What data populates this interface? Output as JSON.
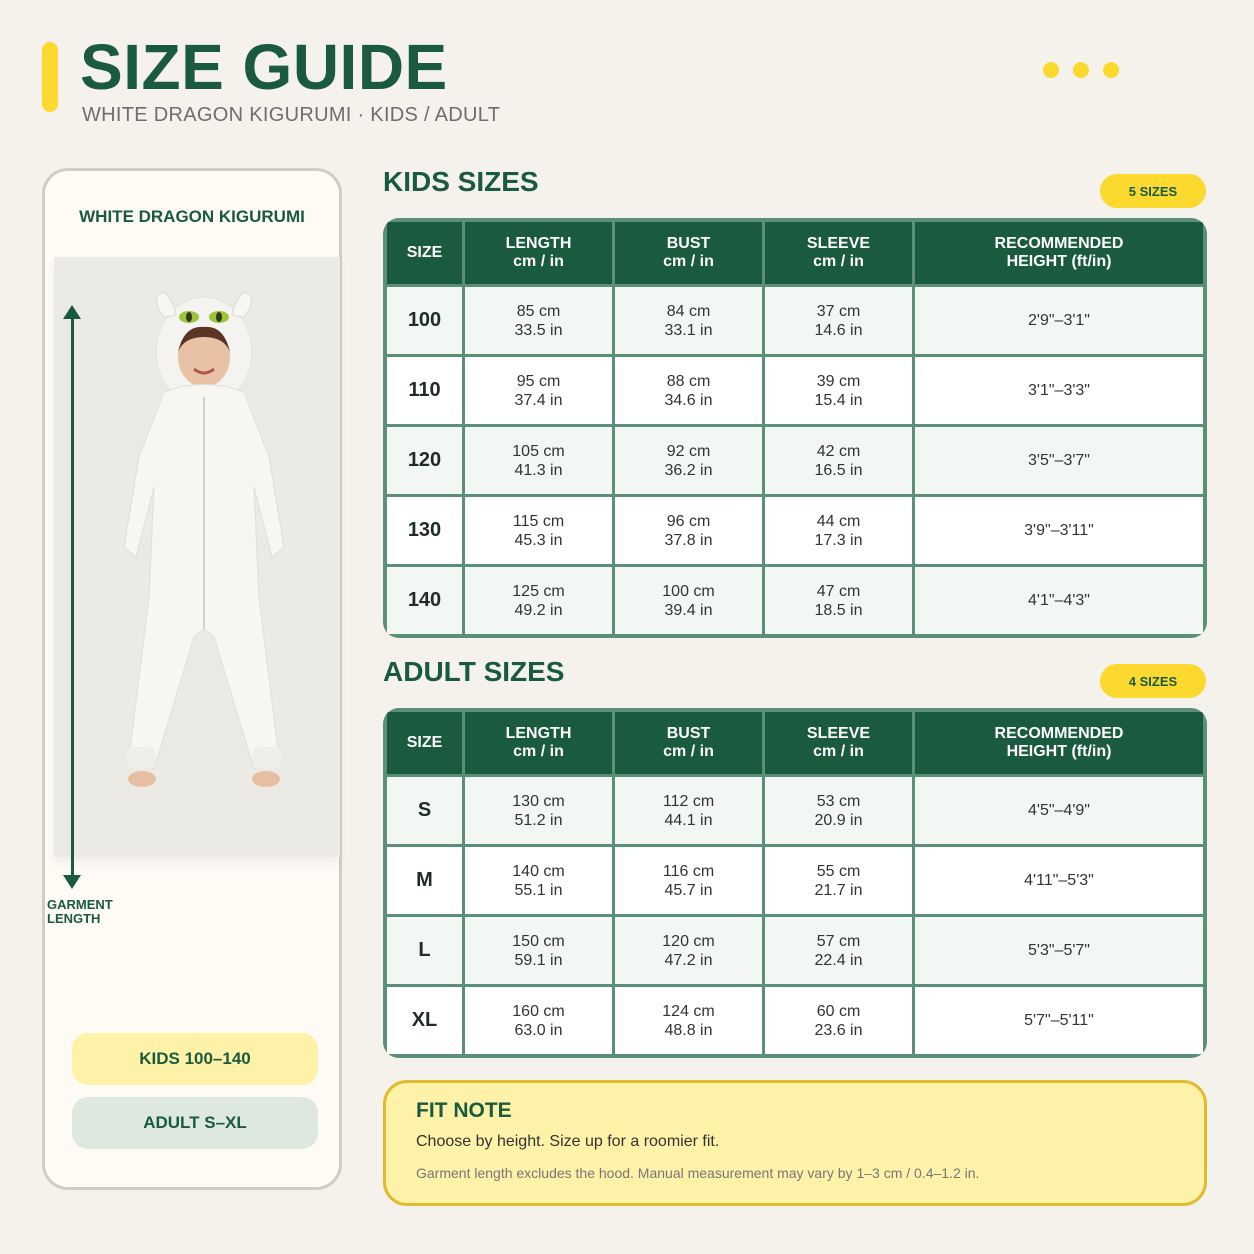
{
  "header": {
    "title": "SIZE GUIDE",
    "subtitle": "WHITE DRAGON KIGURUMI · KIDS / ADULT",
    "accent_color": "#fcd92e",
    "brand_color": "#1a5a3e"
  },
  "left_panel": {
    "title": "WHITE DRAGON KIGURUMI",
    "garment_label": "GARMENT LENGTH",
    "pill_kids": "KIDS 100–140",
    "pill_adult": "ADULT S–XL"
  },
  "kids": {
    "title": "KIDS SIZES",
    "badge": "5 SIZES",
    "headers": [
      {
        "main": "SIZE",
        "sub": ""
      },
      {
        "main": "LENGTH",
        "sub": "cm / in"
      },
      {
        "main": "BUST",
        "sub": "cm / in"
      },
      {
        "main": "SLEEVE",
        "sub": "cm / in"
      },
      {
        "main": "RECOMMENDED",
        "sub": "HEIGHT (ft/in)"
      }
    ],
    "rows": [
      {
        "size": "100",
        "length": [
          "85 cm",
          "33.5 in"
        ],
        "bust": [
          "84 cm",
          "33.1 in"
        ],
        "sleeve": [
          "37 cm",
          "14.6 in"
        ],
        "height": "2'9\"–3'1\""
      },
      {
        "size": "110",
        "length": [
          "95 cm",
          "37.4 in"
        ],
        "bust": [
          "88 cm",
          "34.6 in"
        ],
        "sleeve": [
          "39 cm",
          "15.4 in"
        ],
        "height": "3'1\"–3'3\""
      },
      {
        "size": "120",
        "length": [
          "105 cm",
          "41.3 in"
        ],
        "bust": [
          "92 cm",
          "36.2 in"
        ],
        "sleeve": [
          "42 cm",
          "16.5 in"
        ],
        "height": "3'5\"–3'7\""
      },
      {
        "size": "130",
        "length": [
          "115 cm",
          "45.3 in"
        ],
        "bust": [
          "96 cm",
          "37.8 in"
        ],
        "sleeve": [
          "44 cm",
          "17.3 in"
        ],
        "height": "3'9\"–3'11\""
      },
      {
        "size": "140",
        "length": [
          "125 cm",
          "49.2 in"
        ],
        "bust": [
          "100 cm",
          "39.4 in"
        ],
        "sleeve": [
          "47 cm",
          "18.5 in"
        ],
        "height": "4'1\"–4'3\""
      }
    ]
  },
  "adult": {
    "title": "ADULT SIZES",
    "badge": "4 SIZES",
    "headers": [
      {
        "main": "SIZE",
        "sub": ""
      },
      {
        "main": "LENGTH",
        "sub": "cm / in"
      },
      {
        "main": "BUST",
        "sub": "cm / in"
      },
      {
        "main": "SLEEVE",
        "sub": "cm / in"
      },
      {
        "main": "RECOMMENDED",
        "sub": "HEIGHT (ft/in)"
      }
    ],
    "rows": [
      {
        "size": "S",
        "length": [
          "130 cm",
          "51.2 in"
        ],
        "bust": [
          "112 cm",
          "44.1 in"
        ],
        "sleeve": [
          "53 cm",
          "20.9 in"
        ],
        "height": "4'5\"–4'9\""
      },
      {
        "size": "M",
        "length": [
          "140 cm",
          "55.1 in"
        ],
        "bust": [
          "116 cm",
          "45.7 in"
        ],
        "sleeve": [
          "55 cm",
          "21.7 in"
        ],
        "height": "4'11\"–5'3\""
      },
      {
        "size": "L",
        "length": [
          "150 cm",
          "59.1 in"
        ],
        "bust": [
          "120 cm",
          "47.2 in"
        ],
        "sleeve": [
          "57 cm",
          "22.4 in"
        ],
        "height": "5'3\"–5'7\""
      },
      {
        "size": "XL",
        "length": [
          "160 cm",
          "63.0 in"
        ],
        "bust": [
          "124 cm",
          "48.8 in"
        ],
        "sleeve": [
          "60 cm",
          "23.6 in"
        ],
        "height": "5'7\"–5'11\""
      }
    ]
  },
  "fit_note": {
    "title": "FIT NOTE",
    "main": "Choose by height. Size up for a roomier fit.",
    "small": "Garment length excludes the hood. Manual measurement may vary by 1–3 cm / 0.4–1.2 in."
  }
}
